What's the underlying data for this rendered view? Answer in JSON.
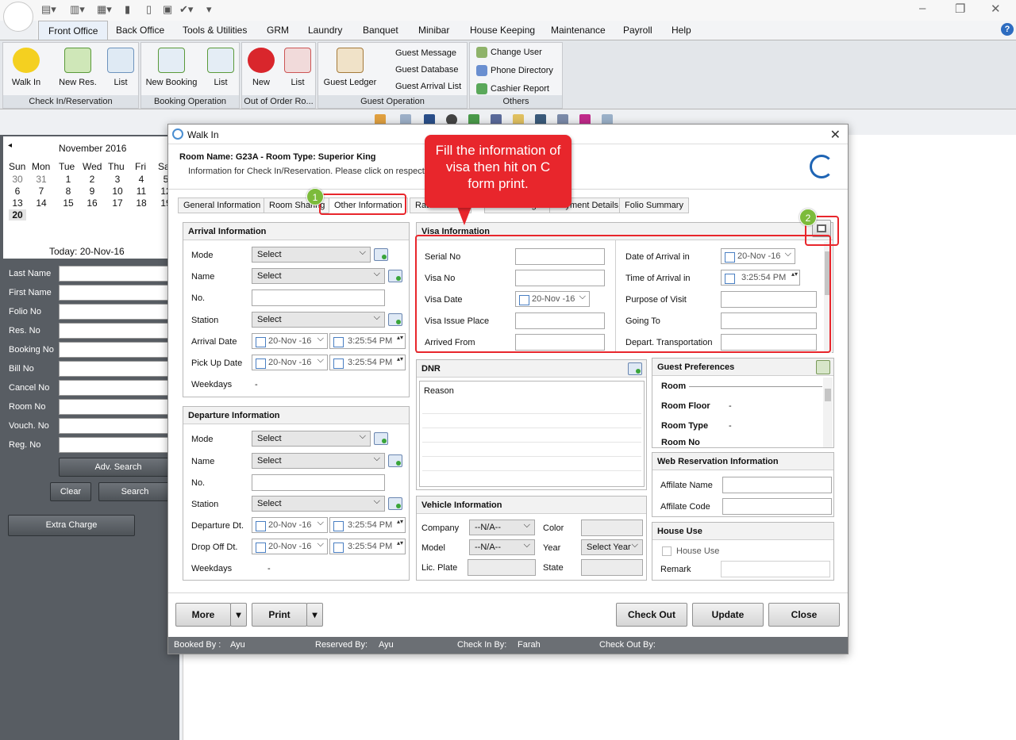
{
  "quick_access": {
    "glyphs": [
      "▤▾",
      "▥▾",
      "▦▾",
      "▮",
      "▯",
      "▣",
      "✔▾",
      "▾"
    ]
  },
  "window_controls": {
    "minimize": "–",
    "restore": "❐",
    "close": "✕"
  },
  "menu": {
    "items": [
      "Front Office",
      "Back Office",
      "Tools & Utilities",
      "GRM",
      "Laundry",
      "Banquet",
      "Minibar",
      "House Keeping",
      "Maintenance",
      "Payroll",
      "Help"
    ],
    "active": "Front Office",
    "help_glyph": "?"
  },
  "ribbon": {
    "group1": {
      "label": "Check In/Reservation",
      "buttons": [
        "Walk In",
        "New Res.",
        "List"
      ]
    },
    "group2": {
      "label": "Booking Operation",
      "buttons": [
        "New Booking",
        "List"
      ]
    },
    "group3": {
      "label": "Out of Order Ro...",
      "buttons": [
        "New",
        "List"
      ]
    },
    "group4": {
      "label": "Guest Operation",
      "buttons": [
        "Guest Ledger"
      ],
      "small": [
        "Guest Message",
        "Guest Database",
        "Guest Arrival List"
      ]
    },
    "group5": {
      "label": "Others",
      "small": [
        "Change User",
        "Phone Directory",
        "Cashier Report"
      ]
    }
  },
  "calendar": {
    "prev_glyph": "◂",
    "month": "November 2016",
    "day_names": [
      "Sun",
      "Mon",
      "Tue",
      "Wed",
      "Thu",
      "Fri",
      "Sa"
    ],
    "weeks": [
      [
        "30",
        "31",
        "1",
        "2",
        "3",
        "4",
        "5"
      ],
      [
        "6",
        "7",
        "8",
        "9",
        "10",
        "11",
        "12"
      ],
      [
        "13",
        "14",
        "15",
        "16",
        "17",
        "18",
        "19"
      ],
      [
        "20",
        "",
        "",
        "",
        "",
        "",
        ""
      ]
    ],
    "today": "Today: 20-Nov-16"
  },
  "search": {
    "fields": [
      "Last Name",
      "First Name",
      "Folio No",
      "Res. No",
      "Booking No",
      "Bill No",
      "Cancel No",
      "Room No",
      "Vouch. No",
      "Reg. No"
    ],
    "adv_search": "Adv. Search",
    "clear": "Clear",
    "search": "Search",
    "extra_charge": "Extra Charge"
  },
  "dialog": {
    "title": "Walk In",
    "close_glyph": "✕",
    "room_name": "Room Name: G23A - Room Type: Superior King",
    "info": "Information for Check In/Reservation. Please click on respecti",
    "tabs": [
      "General Information",
      "Room Sharing",
      "Other Information",
      "Rate Informa",
      "Extra Charges",
      "Payment Details",
      "Folio Summary"
    ],
    "active_tab": "Other Information",
    "arrival": {
      "title": "Arrival Information",
      "labels": [
        "Mode",
        "Name",
        "No.",
        "Station",
        "Arrival Date",
        "Pick Up Date",
        "Weekdays"
      ],
      "select": "Select",
      "date": "20-Nov -16",
      "time": "3:25:54 PM",
      "weekdays": "-"
    },
    "departure": {
      "title": "Departure Information",
      "labels": [
        "Mode",
        "Name",
        "No.",
        "Station",
        "Departure Dt.",
        "Drop Off Dt.",
        "Weekdays"
      ],
      "select": "Select",
      "date": "20-Nov -16",
      "time": "3:25:54 PM",
      "weekdays": "-"
    },
    "visa": {
      "title": "Visa Information",
      "left_labels": [
        "Serial No",
        "Visa No",
        "Visa Date",
        "Visa Issue Place",
        "Arrived From"
      ],
      "visa_date": "20-Nov -16",
      "right_labels": [
        "Date of Arrival in",
        "Time of Arrival in",
        "Purpose of Visit",
        "Going To",
        "Depart. Transportation"
      ],
      "arrival_date": "20-Nov -16",
      "arrival_time": "3:25:54 PM"
    },
    "dnr": {
      "title": "DNR",
      "column": "Reason"
    },
    "guest_pref": {
      "title": "Guest Preferences",
      "rows": [
        {
          "label": "Room",
          "value": ""
        },
        {
          "label": "Room Floor",
          "value": "-"
        },
        {
          "label": "Room Type",
          "value": "-"
        },
        {
          "label": "Room No",
          "value": ""
        }
      ]
    },
    "vehicle": {
      "title": "Vehicle Information",
      "company": "Company",
      "model": "Model",
      "lic_plate": "Lic. Plate",
      "color": "Color",
      "year": "Year",
      "state": "State",
      "na": "--N/A--",
      "select_year": "Select Year"
    },
    "web_res": {
      "title": "Web Reservation Information",
      "affiliate_name": "Affilate Name",
      "affiliate_code": "Affilate Code"
    },
    "house_use": {
      "title": "House Use",
      "checkbox": "House Use",
      "remark": "Remark"
    },
    "buttons": {
      "more": "More",
      "print": "Print",
      "check_out": "Check Out",
      "update": "Update",
      "close": "Close",
      "dropdown": "▾"
    },
    "status": {
      "booked_by": "Booked By :",
      "booked_by_val": "Ayu",
      "reserved_by": "Reserved By:",
      "reserved_by_val": "Ayu",
      "check_in_by": "Check In By:",
      "check_in_by_val": "Farah",
      "check_out_by": "Check Out By:"
    }
  },
  "annotation": {
    "callout": "Fill the information of visa then hit on C form print.",
    "badge1": "1",
    "badge2": "2"
  },
  "colors": {
    "callout_red": "#e8262c",
    "badge_green": "#7cbb3b",
    "accent_blue": "#1e64b4",
    "side_dark": "#585d63"
  }
}
